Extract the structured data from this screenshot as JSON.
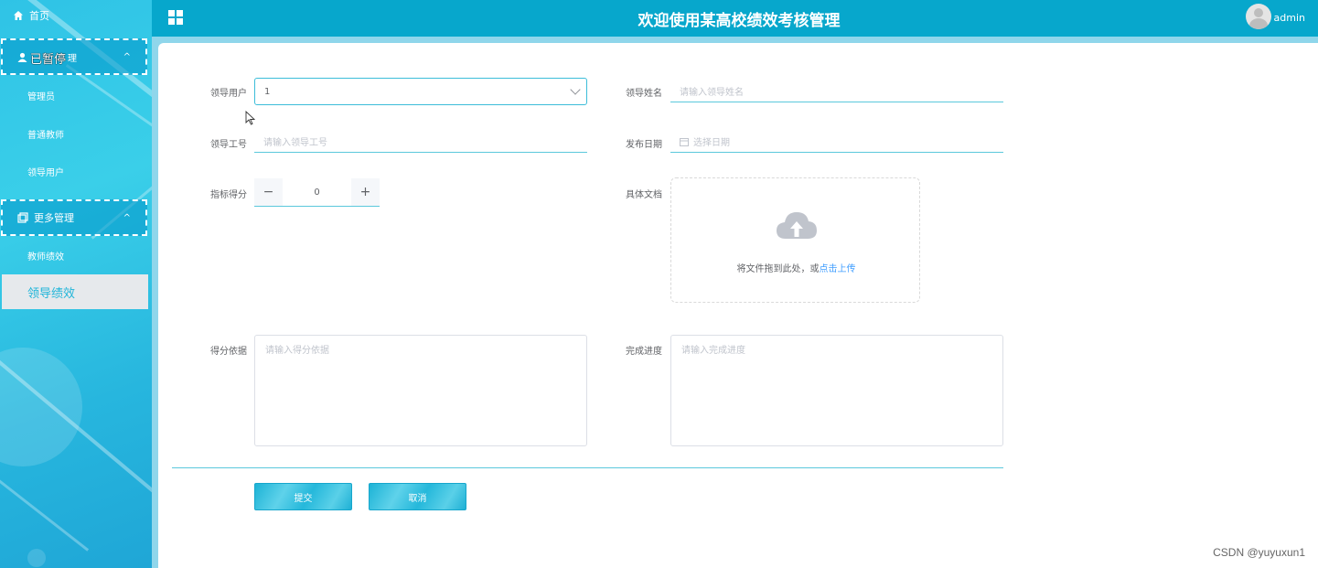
{
  "sidebar": {
    "home_label": "首页",
    "group1": {
      "label": "已暂停",
      "chevron": "^"
    },
    "group1_items": [
      {
        "label": "管理员"
      },
      {
        "label": "普通教师"
      },
      {
        "label": "领导用户"
      }
    ],
    "group2": {
      "label": "更多管理",
      "chevron": "^"
    },
    "group2_items": [
      {
        "label": "教师绩效"
      }
    ],
    "active_item": {
      "label": "领导绩效"
    }
  },
  "header": {
    "title": "欢迎使用某高校绩效考核管理",
    "user": "admin"
  },
  "form": {
    "leader_user": {
      "label": "领导用户",
      "value": "1"
    },
    "leader_name": {
      "label": "领导姓名",
      "placeholder": "请输入领导姓名"
    },
    "leader_id": {
      "label": "领导工号",
      "placeholder": "请输入领导工号"
    },
    "publish_date": {
      "label": "发布日期",
      "placeholder": "选择日期"
    },
    "score": {
      "label": "指标得分",
      "value": "0",
      "minus": "−",
      "plus": "+"
    },
    "document": {
      "label": "具体文档",
      "upload_text": "将文件拖到此处，或",
      "upload_link": "点击上传"
    },
    "basis": {
      "label": "得分依据",
      "placeholder": "请输入得分依据"
    },
    "progress": {
      "label": "完成进度",
      "placeholder": "请输入完成进度"
    },
    "submit_label": "提交",
    "cancel_label": "取消"
  },
  "watermark": "CSDN @yuyuxun1",
  "colors": {
    "header": "#07a7cc",
    "accent": "#5bc8dc",
    "link": "#409eff"
  }
}
